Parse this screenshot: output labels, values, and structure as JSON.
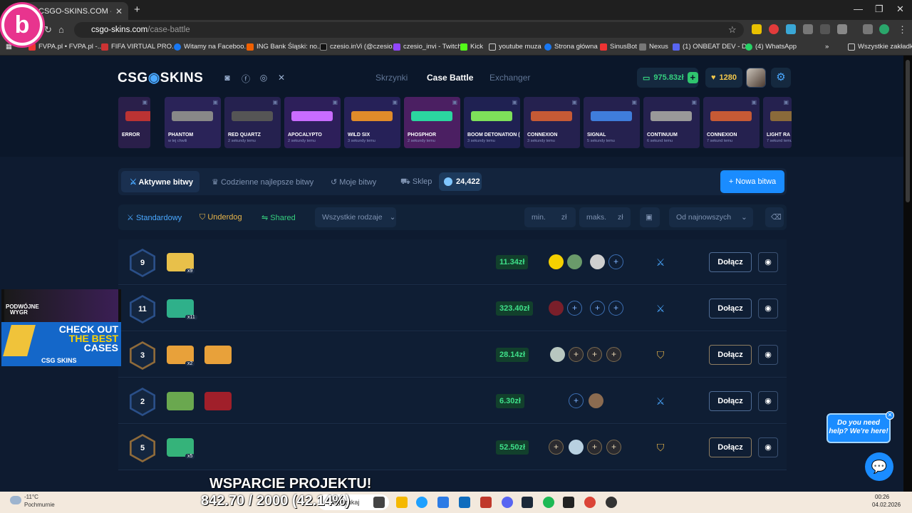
{
  "browser": {
    "tab_title": "CSGO-SKINS.COM - Najlepsze",
    "url_host": "csgo-skins.com",
    "url_path": "/case-battle",
    "bookmarks": [
      "FVPA.pl • FVPA.pl -...",
      "FIFA VIRTUAL PRO...",
      "Witamy na Faceboo...",
      "ING Bank Śląski: no...",
      "czesio.inVi (@czesio...",
      "czesio_invi - Twitch",
      "Kick",
      "youtube muza",
      "Strona główna",
      "SinusBot",
      "Nexus",
      "(1) ONBEAT DEV - D...",
      "(4) WhatsApp"
    ],
    "bookmarks_other": "Wszystkie zakładki"
  },
  "header": {
    "brand_left": "CSG",
    "brand_right": "SKINS",
    "nav": [
      "Skrzynki",
      "Case Battle",
      "Exchanger"
    ],
    "balance": "975.83zł",
    "coins": "1280"
  },
  "drops": [
    {
      "name": "ERROR",
      "time": ""
    },
    {
      "name": "PHANTOM",
      "time": "w tej chwili"
    },
    {
      "name": "RED QUARTZ",
      "time": "2 sekundy temu"
    },
    {
      "name": "APOCALYPTO",
      "time": "2 sekundy temu"
    },
    {
      "name": "WILD SIX",
      "time": "3 sekundy temu"
    },
    {
      "name": "PHOSPHOR",
      "time": "2 sekundy temu"
    },
    {
      "name": "BOOM DETONATION (GLITTER)",
      "time": "3 sekundy temu"
    },
    {
      "name": "CONNEXION",
      "time": "3 sekundy temu"
    },
    {
      "name": "SIGNAL",
      "time": "5 sekundy temu"
    },
    {
      "name": "CONTINUUM",
      "time": "6 sekund temu"
    },
    {
      "name": "CONNEXION",
      "time": "7 sekund temu"
    },
    {
      "name": "LIGHT RA",
      "time": "7 sekund temu"
    }
  ],
  "tabs": {
    "active": "Aktywne bitwy",
    "daily": "Codzienne najlepsze bitwy",
    "mine": "Moje bitwy",
    "shop": "Sklep",
    "gems": "24,422",
    "new_battle": "+ Nowa bitwa"
  },
  "filters": {
    "standard": "Standardowy",
    "underdog": "Underdog",
    "shared": "Shared",
    "all_types": "Wszystkie rodzaje",
    "min": "min.",
    "max": "maks.",
    "currency": "zł",
    "sort": "Od najnowszych"
  },
  "battles": [
    {
      "rounds": "9",
      "mult": "x9",
      "price": "11.34zł",
      "join": "Dołącz"
    },
    {
      "rounds": "11",
      "mult": "x11",
      "price": "323.40zł",
      "join": "Dołącz"
    },
    {
      "rounds": "3",
      "mult": "x2",
      "price": "28.14zł",
      "join": "Dołącz"
    },
    {
      "rounds": "2",
      "mult": "",
      "price": "6.30zł",
      "join": "Dołącz"
    },
    {
      "rounds": "5",
      "mult": "x5",
      "price": "52.50zł",
      "join": "Dołącz"
    }
  ],
  "promo": {
    "line1": "PODWÓJNE",
    "line2": "WYGR",
    "check": "CHECK OUT",
    "the_best": "THE BEST",
    "cases": "CASES",
    "brand": "CSG SKINS"
  },
  "help": "Do you need help? We're here!",
  "stream": {
    "title": "WSPARCIE PROJEKTU!",
    "progress": "842.70 / 2000 (42.14%)"
  },
  "taskbar": {
    "temp": "-11°C",
    "weather": "Pochmurnie",
    "search": "Wyszukaj",
    "time": "00:26",
    "date": "04.02.2026"
  },
  "colors": {
    "accent": "#1a8cff",
    "green": "#3fe08a",
    "gold": "#e8b54a"
  }
}
